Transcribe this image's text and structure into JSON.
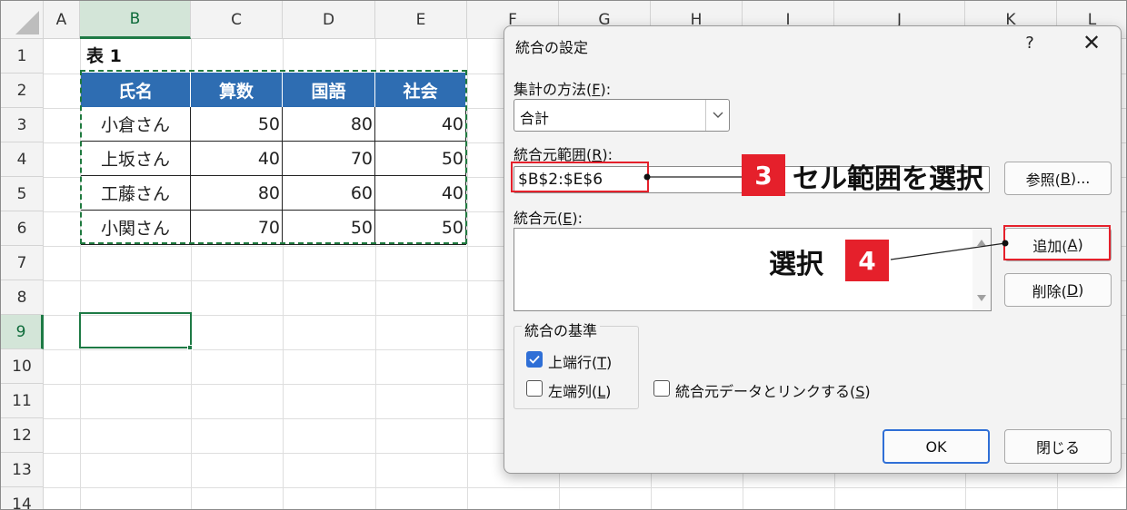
{
  "sheet": {
    "columns": [
      "A",
      "B",
      "C",
      "D",
      "E",
      "F",
      "G",
      "H",
      "I",
      "J",
      "K",
      "L"
    ],
    "rows": [
      "1",
      "2",
      "3",
      "4",
      "5",
      "6",
      "7",
      "8",
      "9",
      "10",
      "11",
      "12",
      "13",
      "14"
    ],
    "selected_column": "B",
    "selected_row": "9",
    "table_title": "表 1",
    "table": {
      "headers": [
        "氏名",
        "算数",
        "国語",
        "社会"
      ],
      "rows": [
        [
          "小倉さん",
          "50",
          "80",
          "40"
        ],
        [
          "上坂さん",
          "40",
          "70",
          "50"
        ],
        [
          "工藤さん",
          "80",
          "60",
          "40"
        ],
        [
          "小関さん",
          "70",
          "50",
          "50"
        ]
      ]
    },
    "header_color": "#2e6db2",
    "selection_color": "#1e7a45"
  },
  "dialog": {
    "title": "統合の設定",
    "help": "?",
    "close": "✕",
    "function_label": {
      "text": "集計の方法(",
      "key": "F",
      "tail": "):"
    },
    "function_value": "合計",
    "reference_label": {
      "text": "統合元範囲(",
      "key": "R",
      "tail": "):"
    },
    "reference_value": "$B$2:$E$6",
    "browse_button": {
      "text": "参照(",
      "key": "B",
      "tail": ")..."
    },
    "all_refs_label": {
      "text": "統合元(",
      "key": "E",
      "tail": "):"
    },
    "add_button": {
      "text": "追加(",
      "key": "A",
      "tail": ")"
    },
    "delete_button": {
      "text": "削除(",
      "key": "D",
      "tail": ")"
    },
    "use_labels_group": "統合の基準",
    "top_row": {
      "text": "上端行(",
      "key": "T",
      "tail": ")",
      "checked": true
    },
    "left_column": {
      "text": "左端列(",
      "key": "L",
      "tail": ")",
      "checked": false
    },
    "create_links": {
      "text": "統合元データとリンクする(",
      "key": "S",
      "tail": ")",
      "checked": false
    },
    "ok_button": "OK",
    "close_button": "閉じる"
  },
  "annotations": {
    "step3_number": "3",
    "step3_text": "セル範囲を選択",
    "step4_number": "4",
    "step4_text": "選択",
    "accent_color": "#e5202b"
  }
}
